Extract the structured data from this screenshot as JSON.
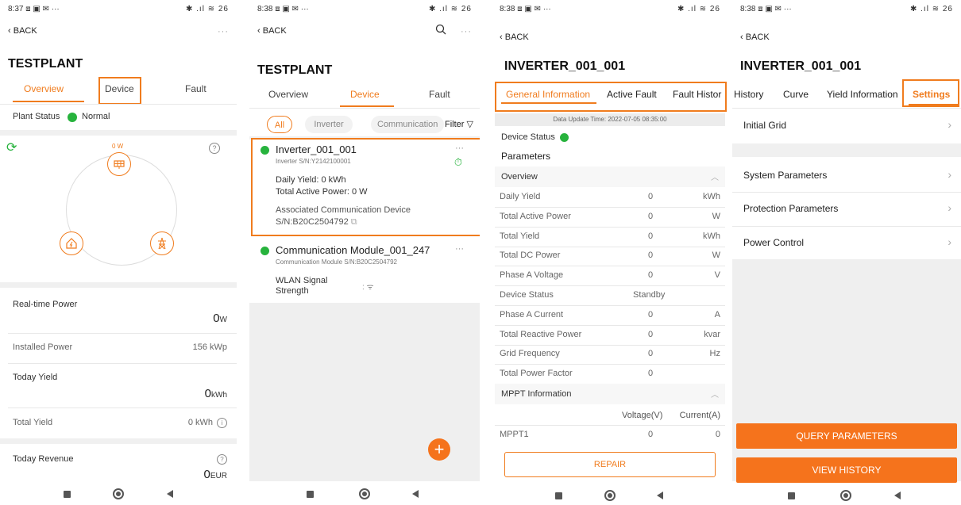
{
  "screen1": {
    "status_time": "8:37",
    "status_extra": "⧈ ▣ ✉ ···",
    "status_right": "✱ .ıl ≋ 26",
    "back": "BACK",
    "more": "···",
    "title": "TESTPLANT",
    "tabs": [
      "Overview",
      "Device",
      "Fault"
    ],
    "plant_status_label": "Plant Status",
    "plant_status_value": "Normal",
    "flow_power": "0 W",
    "realtime_power_label": "Real-time Power",
    "realtime_power_value": "0",
    "realtime_power_unit": "W",
    "installed_power_label": "Installed Power",
    "installed_power_value": "156 kWp",
    "today_yield_label": "Today Yield",
    "today_yield_value": "0",
    "today_yield_unit": "kWh",
    "total_yield_label": "Total Yield",
    "total_yield_value": "0 kWh",
    "today_revenue_label": "Today Revenue",
    "today_revenue_value": "0",
    "today_revenue_unit": "EUR",
    "help": "?",
    "info": "i"
  },
  "screen2": {
    "status_time": "8:38",
    "status_extra": "⧈ ▣ ✉ ···",
    "status_right": "✱ .ıl ≋ 26",
    "back": "BACK",
    "more": "···",
    "title": "TESTPLANT",
    "tabs": [
      "Overview",
      "Device",
      "Fault"
    ],
    "chips": [
      "All",
      "Inverter",
      "Communication"
    ],
    "filter": "Filter",
    "device1": {
      "name": "Inverter_001_001",
      "sn": "Inverter S/N:Y2142100001",
      "daily_yield": "Daily Yield: 0 kWh",
      "active_power": "Total Active Power: 0 W",
      "assoc": "Associated Communication Device",
      "assoc_sn": "S/N:B20C2504792",
      "more": "···"
    },
    "device2": {
      "name": "Communication Module_001_247",
      "sn": "Communication Module S/N:B20C2504792",
      "wlan_label_1": "WLAN Signal",
      "wlan_label_2": "Strength",
      "wlan_value": ": ᯤ",
      "more": "···"
    },
    "add": "+"
  },
  "screen3": {
    "status_time": "8:38",
    "status_extra": "⧈ ▣ ✉ ···",
    "status_right": "✱ .ıl ≋ 26",
    "back": "BACK",
    "title": "INVERTER_001_001",
    "tabs": [
      "General Information",
      "Active Fault",
      "Fault Histor"
    ],
    "update_time": "Data Update Time: 2022-07-05 08:35:00",
    "device_status": "Device Status",
    "parameters": "Parameters",
    "overview": "Overview",
    "rows": [
      {
        "label": "Daily Yield",
        "value": "0",
        "unit": "kWh"
      },
      {
        "label": "Total Active Power",
        "value": "0",
        "unit": "W"
      },
      {
        "label": "Total Yield",
        "value": "0",
        "unit": "kWh"
      },
      {
        "label": "Total DC Power",
        "value": "0",
        "unit": "W"
      },
      {
        "label": "Phase A Voltage",
        "value": "0",
        "unit": "V"
      },
      {
        "label": "Device Status",
        "value": "Standby",
        "unit": ""
      },
      {
        "label": "Phase A Current",
        "value": "0",
        "unit": "A"
      },
      {
        "label": "Total Reactive Power",
        "value": "0",
        "unit": "kvar"
      },
      {
        "label": "Grid Frequency",
        "value": "0",
        "unit": "Hz"
      },
      {
        "label": "Total Power Factor",
        "value": "0",
        "unit": ""
      }
    ],
    "mppt_title": "MPPT Information",
    "mppt_voltage": "Voltage(V)",
    "mppt_current": "Current(A)",
    "mppt_row": {
      "label": "MPPT1",
      "voltage": "0",
      "current": "0"
    },
    "repair": "REPAIR"
  },
  "screen4": {
    "status_time": "8:38",
    "status_extra": "⧈ ▣ ✉ ···",
    "status_right": "✱ .ıl ≋ 26",
    "back": "BACK",
    "title": "INVERTER_001_001",
    "tabs": [
      "History",
      "Curve",
      "Yield Information",
      "Settings"
    ],
    "items": [
      "Initial Grid",
      "System Parameters",
      "Protection Parameters",
      "Power Control"
    ],
    "query": "QUERY PARAMETERS",
    "view_history": "VIEW HISTORY"
  },
  "colors": {
    "accent": "#f07c1e",
    "green": "#27b33d",
    "button": "#f5731c"
  }
}
